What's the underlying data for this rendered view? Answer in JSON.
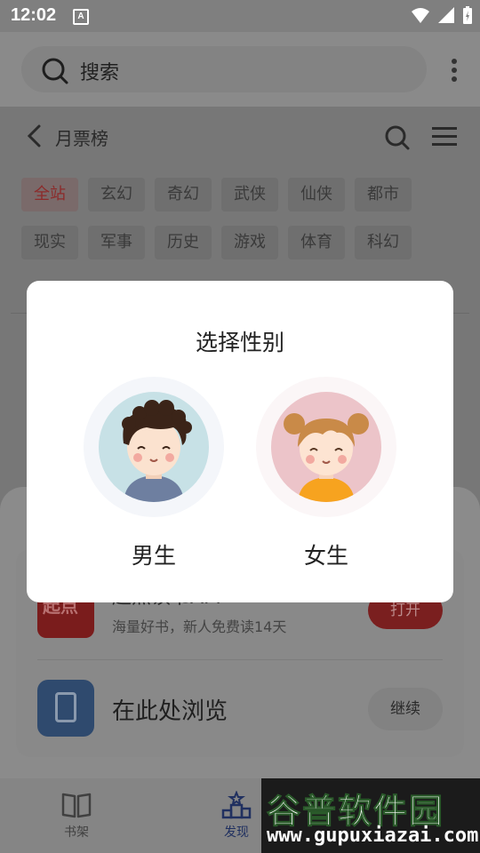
{
  "status_bar": {
    "time": "12:02",
    "indicator": "A"
  },
  "browser": {
    "search_label": "搜索"
  },
  "page": {
    "title": "月票榜",
    "categories": [
      {
        "label": "全站",
        "active": true
      },
      {
        "label": "玄幻"
      },
      {
        "label": "奇幻"
      },
      {
        "label": "武侠"
      },
      {
        "label": "仙侠"
      },
      {
        "label": "都市"
      },
      {
        "label": "现实"
      },
      {
        "label": "军事"
      },
      {
        "label": "历史"
      },
      {
        "label": "游戏"
      },
      {
        "label": "体育"
      },
      {
        "label": "科幻"
      }
    ]
  },
  "app_sheet": {
    "logo_text": "起点",
    "app_title": "起点读书APP",
    "app_subtitle": "海量好书，新人免费读14天",
    "open_button": "打开",
    "browse_title": "在此处浏览",
    "continue_button": "继续"
  },
  "bottom_nav": {
    "items": [
      {
        "label": "书架",
        "icon": "book-open-icon"
      },
      {
        "label": "发现",
        "icon": "discover-icon",
        "active": true
      }
    ]
  },
  "dialog": {
    "title": "选择性别",
    "options": [
      {
        "label": "男生",
        "avatar": "boy-avatar"
      },
      {
        "label": "女生",
        "avatar": "girl-avatar"
      }
    ]
  },
  "watermark": {
    "title": "谷普软件园",
    "url": "www.gupuxiazai.com"
  },
  "colors": {
    "accent_red": "#e03a3a",
    "nav_active": "#2b4a8e",
    "dim_overlay": "#7f7f7f"
  }
}
